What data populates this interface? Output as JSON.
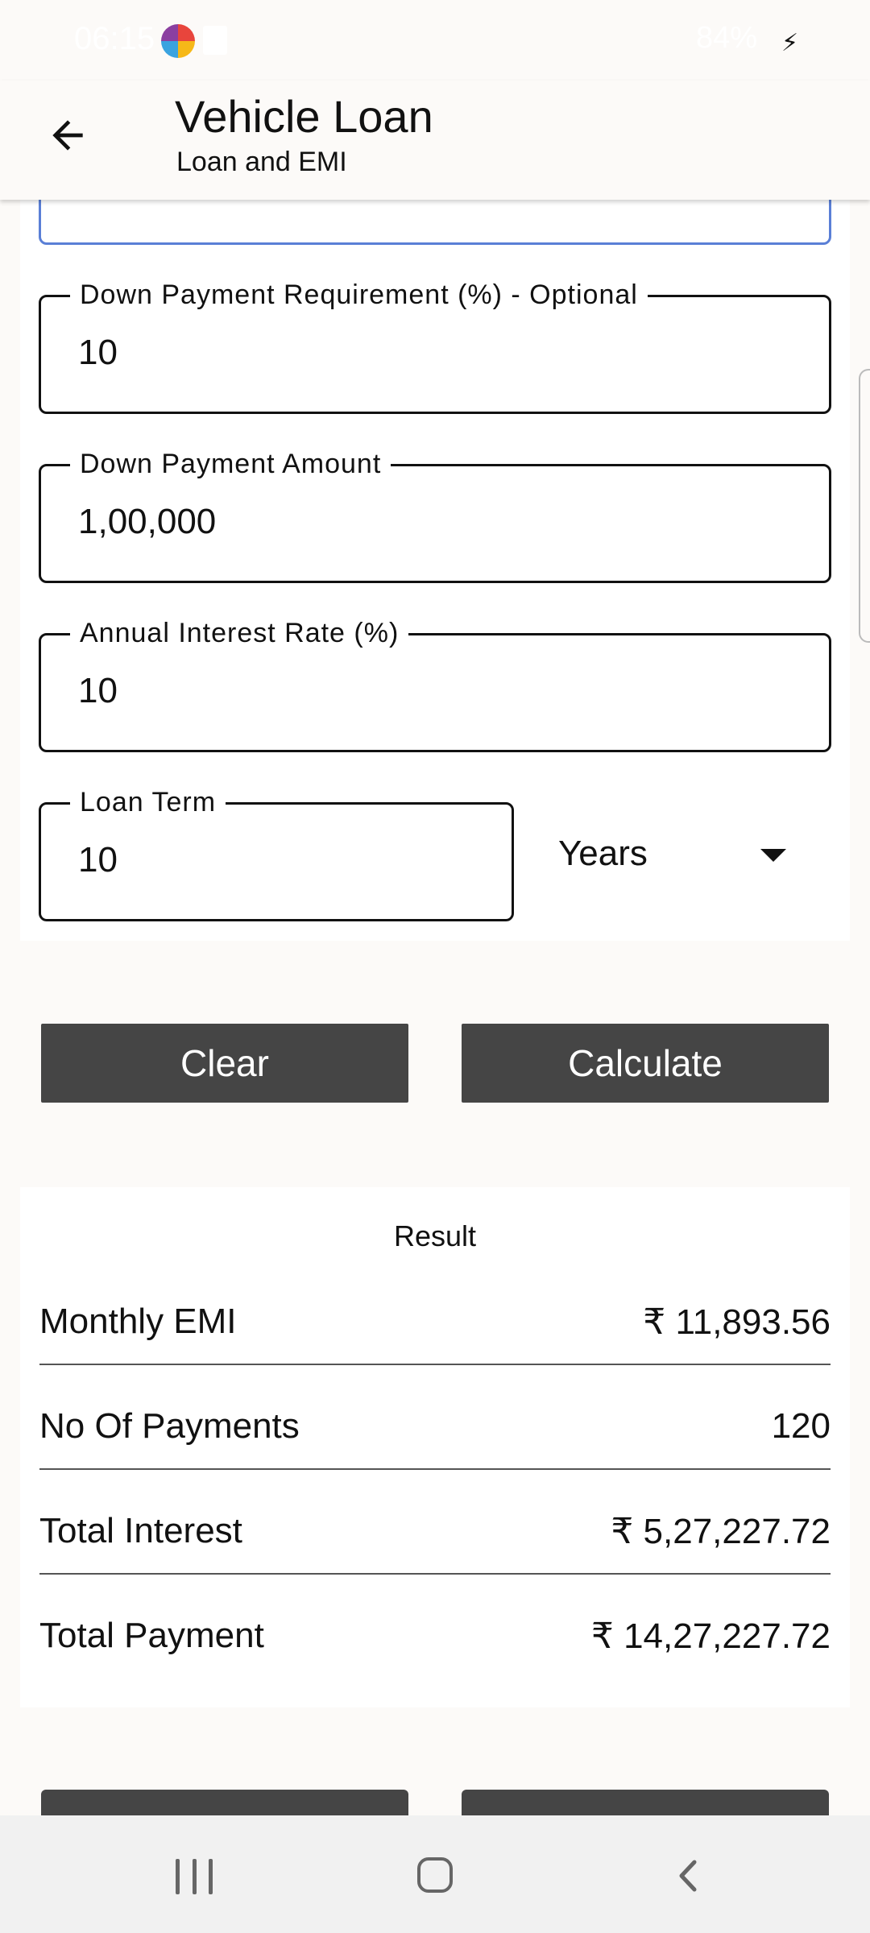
{
  "status_bar": {
    "time": "06:15",
    "right": "84%"
  },
  "app_bar": {
    "title": "Vehicle Loan",
    "subtitle": "Loan and EMI"
  },
  "form": {
    "down_payment_req": {
      "label": "Down Payment Requirement (%) - Optional",
      "value": "10"
    },
    "down_payment_amount": {
      "label": "Down Payment Amount",
      "value": "1,00,000"
    },
    "interest_rate": {
      "label": "Annual Interest Rate (%)",
      "value": "10"
    },
    "loan_term": {
      "label": "Loan Term",
      "value": "10"
    },
    "term_unit": "Years"
  },
  "buttons": {
    "clear": "Clear",
    "calculate": "Calculate"
  },
  "result": {
    "title": "Result",
    "rows": [
      {
        "label": "Monthly EMI",
        "value": "₹ 11,893.56"
      },
      {
        "label": "No Of Payments",
        "value": "120"
      },
      {
        "label": "Total Interest",
        "value": "₹ 5,27,227.72"
      },
      {
        "label": "Total Payment",
        "value": "₹ 14,27,227.72"
      }
    ]
  }
}
